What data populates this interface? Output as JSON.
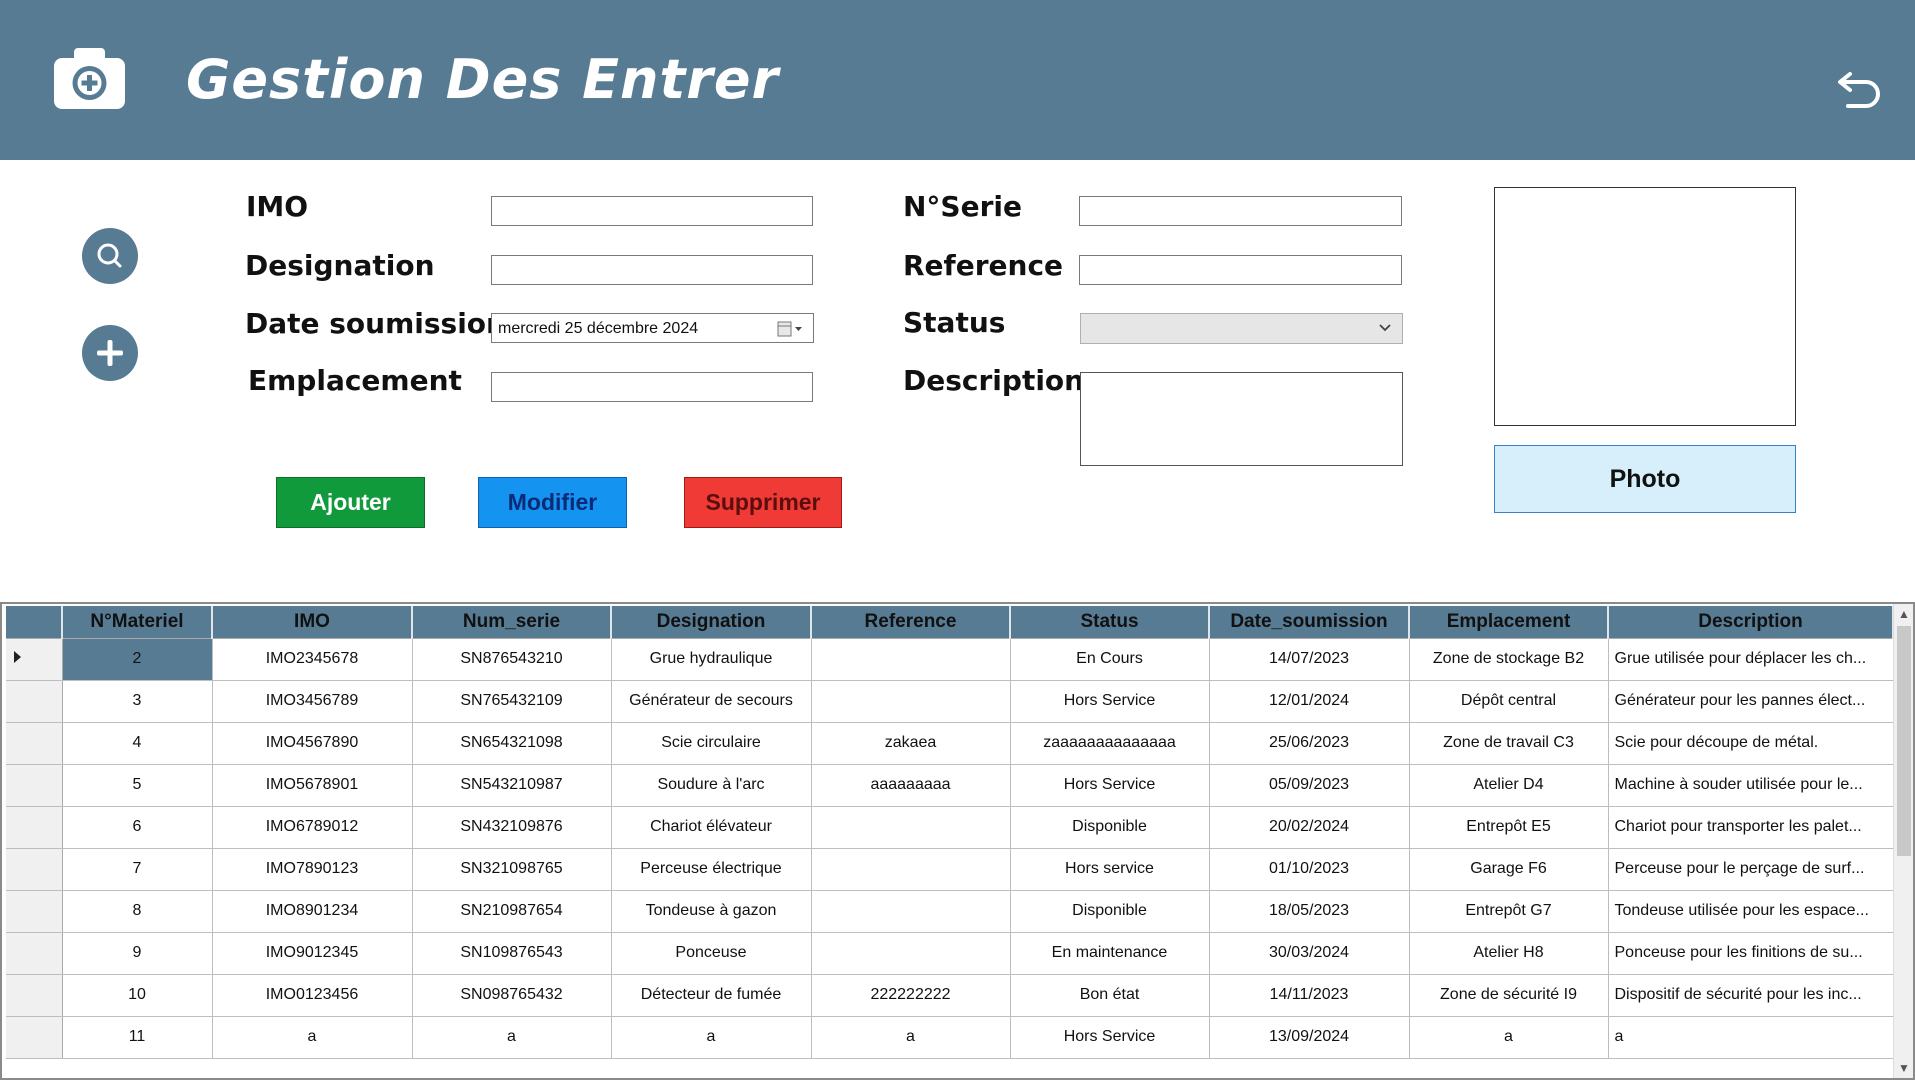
{
  "header": {
    "title": "Gestion Des Entrer",
    "icon": "camera-plus-icon",
    "back_icon": "undo-icon",
    "bg_color": "#587b94"
  },
  "form": {
    "imo_label": "IMO",
    "designation_label": "Designation",
    "date_label": "Date soumission",
    "date_value": "mercredi  25 décembre 2024",
    "emplacement_label": "Emplacement",
    "serie_label": "N°Serie",
    "reference_label": "Reference",
    "status_label": "Status",
    "description_label": "Description",
    "imo_value": "",
    "designation_value": "",
    "emplacement_value": "",
    "serie_value": "",
    "reference_value": "",
    "status_value": "",
    "description_value": ""
  },
  "actions": {
    "add": "Ajouter",
    "modify": "Modifier",
    "delete": "Supprimer",
    "photo": "Photo"
  },
  "table": {
    "columns": [
      "N°Materiel",
      "IMO",
      "Num_serie",
      "Designation",
      "Reference",
      "Status",
      "Date_soumission",
      "Emplacement",
      "Description"
    ],
    "rows": [
      [
        "2",
        "IMO2345678",
        "SN876543210",
        "Grue hydraulique",
        "",
        "En Cours",
        "14/07/2023",
        "Zone de stockage B2",
        "Grue utilisée pour déplacer les ch..."
      ],
      [
        "3",
        "IMO3456789",
        "SN765432109",
        "Générateur de secours",
        "",
        "Hors Service",
        "12/01/2024",
        "Dépôt central",
        "Générateur pour les pannes élect..."
      ],
      [
        "4",
        "IMO4567890",
        "SN654321098",
        "Scie circulaire",
        "zakaea",
        "zaaaaaaaaaaaaaa",
        "25/06/2023",
        "Zone de travail C3",
        "Scie pour découpe de métal."
      ],
      [
        "5",
        "IMO5678901",
        "SN543210987",
        "Soudure à l'arc",
        "aaaaaaaaa",
        "Hors Service",
        "05/09/2023",
        "Atelier D4",
        "Machine à souder utilisée pour le..."
      ],
      [
        "6",
        "IMO6789012",
        "SN432109876",
        "Chariot élévateur",
        "",
        "Disponible",
        "20/02/2024",
        "Entrepôt E5",
        "Chariot pour transporter les palet..."
      ],
      [
        "7",
        "IMO7890123",
        "SN321098765",
        "Perceuse électrique",
        "",
        "Hors service",
        "01/10/2023",
        "Garage F6",
        "Perceuse pour le perçage de surf..."
      ],
      [
        "8",
        "IMO8901234",
        "SN210987654",
        "Tondeuse à gazon",
        "",
        "Disponible",
        "18/05/2023",
        "Entrepôt G7",
        "Tondeuse utilisée pour les espace..."
      ],
      [
        "9",
        "IMO9012345",
        "SN109876543",
        "Ponceuse",
        "",
        "En maintenance",
        "30/03/2024",
        "Atelier H8",
        "Ponceuse pour les finitions de su..."
      ],
      [
        "10",
        "IMO0123456",
        "SN098765432",
        "Détecteur de fumée",
        "222222222",
        "Bon état",
        "14/11/2023",
        "Zone de sécurité I9",
        "Dispositif de sécurité pour les inc..."
      ],
      [
        "11",
        "a",
        "a",
        "a",
        "a",
        "Hors Service",
        "13/09/2024",
        "a",
        "a"
      ]
    ]
  }
}
